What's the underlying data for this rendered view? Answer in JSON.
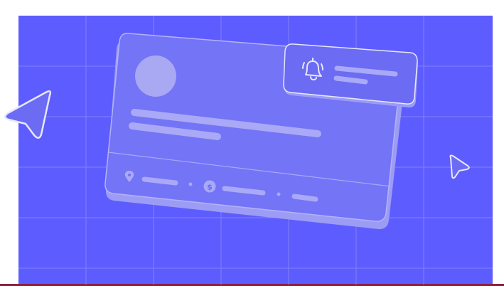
{
  "colors": {
    "page_background": "#ffffff",
    "panel_background": "#5d5cff",
    "grid_line": "#8f8ff7",
    "card_fill": "#7474f6",
    "card_shadow": "#9c9cf5",
    "card_stroke": "#b3b3fb",
    "placeholder_bar": "#a9a9f7",
    "avatar": "#a8a8f3",
    "notification_fill": "#6b6bf3",
    "icon_stroke": "#e7e7ff",
    "bottom_edge": "#8c1f3f"
  },
  "illustration": {
    "card": {
      "avatar": "avatar-placeholder",
      "text_lines": 3,
      "footer_items": [
        {
          "icon": "location-pin-icon"
        },
        {
          "icon": "dollar-coin-icon"
        },
        {
          "icon": "none"
        }
      ]
    },
    "notification": {
      "icon": "bell-icon",
      "text_lines": 2
    },
    "pointers": [
      {
        "icon": "cursor-arrow-icon-large"
      },
      {
        "icon": "cursor-arrow-icon-small"
      }
    ]
  }
}
